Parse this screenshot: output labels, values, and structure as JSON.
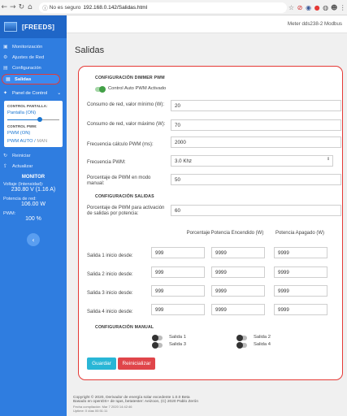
{
  "browser": {
    "security": "No es seguro",
    "url": "192.168.0.142/Salidas.html"
  },
  "sidebar": {
    "logo": "[FREEDS]",
    "items": [
      {
        "label": "Monitorización",
        "icon": "monitor-icon"
      },
      {
        "label": "Ajustes de Red",
        "icon": "network-icon"
      },
      {
        "label": "Configuración",
        "icon": "config-icon"
      },
      {
        "label": "Salidas",
        "icon": "outputs-icon"
      }
    ],
    "panel_control": "Panel de Control",
    "control": {
      "pantalla_caption": "CONTROL PANTALLA:",
      "pantalla_value": "Pantalla (ON)",
      "slider_level": 0.62,
      "pwm_caption": "CONTROL PWM:",
      "pwm_value": "PWM (ON)",
      "pwm_auto": "PWM AUTO",
      "pwm_sep": "/",
      "pwm_man": "MAN"
    },
    "reiniciar": "Reiniciar",
    "actualizar": "Actualizar",
    "monitor": {
      "title": "MONITOR",
      "voltage_label": "Voltaje (Intensidad):",
      "voltage_value": "230.80 V (1.16 A)",
      "power_label": "Potencia de red:",
      "power_value": "106.00 W",
      "pwm_label": "PWM:",
      "pwm_value": "100 %"
    }
  },
  "header": {
    "device": "Meter dds238-2 Modbus"
  },
  "page": {
    "title": "Salidas",
    "dimmer": {
      "section": "CONFIGURACIÓN DIMMER PWM",
      "toggle_label": "Control Auto PWM Activado",
      "consumo_min_label": "Consumo de red, valor mínimo (W):",
      "consumo_min_value": "20",
      "consumo_max_label": "Consumo de red, valor máximo (W):",
      "consumo_max_value": "70",
      "freq_calc_label": "Frecuencia cálculo PWM (ms):",
      "freq_calc_value": "2000",
      "freq_pwm_label": "Frecuencia PWM:",
      "freq_pwm_value": "3.0 Khz",
      "pct_manual_label": "Porcentaje de PWM en modo manual:",
      "pct_manual_value": "50"
    },
    "salidas": {
      "section": "CONFIGURACIÓN SALIDAS",
      "pct_activacion_label": "Porcentaje de PWM para activación de salidas por potencia:",
      "pct_activacion_value": "60",
      "col_pct": "Porcentaje",
      "col_on": "Potencia Encendido (W)",
      "col_off": "Potencia Apagado (W)",
      "rows": [
        {
          "label": "Salida 1 inicio desde:",
          "pct": "999",
          "on": "9999",
          "off": "9999"
        },
        {
          "label": "Salida 2 inicio desde:",
          "pct": "999",
          "on": "9999",
          "off": "9999"
        },
        {
          "label": "Salida 3 inicio desde:",
          "pct": "999",
          "on": "9999",
          "off": "9999"
        },
        {
          "label": "Salida 4 inicio desde:",
          "pct": "999",
          "on": "9999",
          "off": "9999"
        }
      ]
    },
    "manual": {
      "section": "CONFIGURACIÓN MANUAL",
      "s1": "Salida 1",
      "s2": "Salida 2",
      "s3": "Salida 3",
      "s4": "Salida 4"
    },
    "buttons": {
      "save": "Guardar",
      "reset": "Reinicializar"
    }
  },
  "footer": {
    "line1": "Copyright © 2020, Derivador de energía solar excedente 1.0.0 Beta",
    "line2": "Basado en openDS+ de Iqas, betatester: Aeizoon, (C) 2020 Pablo Zerón",
    "line3": "Fecha compilación: Mar 7 2020 14:42:46",
    "line4": "Uptime: 0 días 00:51:11"
  },
  "colors": {
    "sidebar": "#2f7de0",
    "accent": "#1976d2",
    "highlight": "#e53935",
    "save": "#29b6d6",
    "reset": "#e0454a"
  }
}
